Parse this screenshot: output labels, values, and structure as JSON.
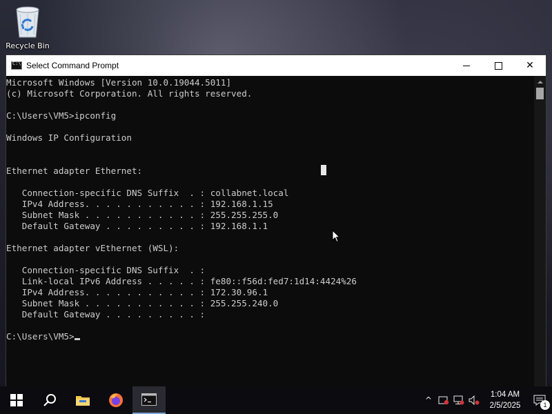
{
  "desktop": {
    "icons": [
      {
        "label": "Recycle Bin",
        "icon": "recycle-bin-icon"
      }
    ]
  },
  "window": {
    "title": "Select Command Prompt",
    "icon": "cmd-icon",
    "controls": {
      "minimize": "minimize-icon",
      "maximize": "maximize-icon",
      "close": "✕"
    }
  },
  "console": {
    "lines": [
      "Microsoft Windows [Version 10.0.19044.5011]",
      "(c) Microsoft Corporation. All rights reserved.",
      "",
      "C:\\Users\\VM5>ipconfig",
      "",
      "Windows IP Configuration",
      "",
      "",
      "Ethernet adapter Ethernet:",
      "",
      "   Connection-specific DNS Suffix  . : collabnet.local",
      "   IPv4 Address. . . . . . . . . . . : 192.168.1.15",
      "   Subnet Mask . . . . . . . . . . . : 255.255.255.0",
      "   Default Gateway . . . . . . . . . : 192.168.1.1",
      "",
      "Ethernet adapter vEthernet (WSL):",
      "",
      "   Connection-specific DNS Suffix  . :",
      "   Link-local IPv6 Address . . . . . : fe80::f56d:fed7:1d14:4424%26",
      "   IPv4 Address. . . . . . . . . . . : 172.30.96.1",
      "   Subnet Mask . . . . . . . . . . . : 255.255.240.0",
      "   Default Gateway . . . . . . . . . :",
      "",
      "C:\\Users\\VM5>"
    ]
  },
  "taskbar": {
    "apps": [
      {
        "name": "start-button",
        "icon": "windows-logo-icon"
      },
      {
        "name": "search-button",
        "icon": "search-icon"
      },
      {
        "name": "file-explorer-button",
        "icon": "folder-icon"
      },
      {
        "name": "firefox-button",
        "icon": "firefox-icon"
      },
      {
        "name": "command-prompt-button",
        "icon": "cmd-icon",
        "active": true
      }
    ],
    "tray": {
      "chevron": "^",
      "time": "1:04 AM",
      "date": "2/5/2025",
      "notification_count": "1"
    }
  },
  "colors": {
    "console_bg": "#0c0c0c",
    "console_text": "#cccccc",
    "titlebar_bg": "#ffffff",
    "taskbar_bg": "#0b0b10"
  }
}
